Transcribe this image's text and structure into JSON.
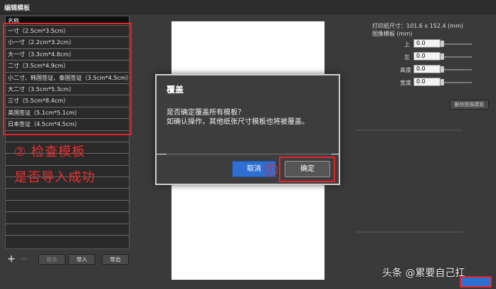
{
  "window": {
    "title": "编辑模板"
  },
  "list": {
    "header": "名称",
    "items": [
      "一寸（2.5cm*3.5cm）",
      "小一寸（2.2cm*3.2cm）",
      "大一寸（3.3cm*4.8cm）",
      "二寸（3.5cm*4.9cm）",
      "小二寸、韩国签证、泰国签证（3.5cm*4.5cm）",
      "大二寸（3.5cm*5.3cm）",
      "三寸（5.5cm*8.4cm）",
      "美国签证（5.1cm*5.1cm）",
      "日本签证（4.5cm*4.5cm）"
    ]
  },
  "toolbar": {
    "add_icon": "+",
    "remove_icon": "—",
    "copy_label": "副本",
    "import_label": "导入",
    "export_label": "导出"
  },
  "annotations": {
    "step2_line1": "② 检查模板",
    "step2_line2": "是否导入成功",
    "step1_marker": "①"
  },
  "right_panel": {
    "paper_size": "打印纸尺寸：101.6 x 152.4 (mm)",
    "image_template": "图像模板 (mm)",
    "top_label": "上",
    "top_value": "0.0",
    "left_label": "左",
    "left_value": "0.0",
    "height_label": "高度",
    "height_value": "0.0",
    "width_label": "宽度",
    "width_value": "0.0",
    "delete_image_template": "删除图像模板"
  },
  "dialog": {
    "title": "覆盖",
    "message_line1": "是否确定覆盖所有模板？",
    "message_line2": "如确认操作，其他纸张尺寸模板也将被覆盖。",
    "cancel_label": "取消",
    "ok_label": "确定"
  },
  "watermark": "头条 @累要自己扛",
  "colors": {
    "accent_blue": "#2f6fd1",
    "annotation_red": "#e0262b",
    "dialog_bg": "#3d3d3d"
  }
}
